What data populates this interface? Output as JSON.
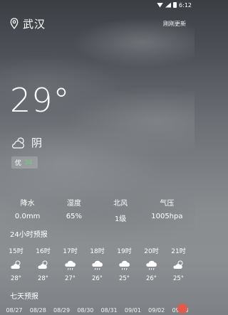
{
  "status_bar": {
    "time": "6:12"
  },
  "header": {
    "city": "武汉",
    "updated": "刚刚更新"
  },
  "current": {
    "temperature": "29°",
    "condition": "阴",
    "condition_icon": "cloud-sun-icon",
    "aqi_label": "优",
    "aqi_value": "34",
    "aqi_color": "#6fd06f"
  },
  "stats": [
    {
      "label": "降水",
      "value": "0.0mm"
    },
    {
      "label": "湿度",
      "value": "65%"
    },
    {
      "label": "北风",
      "value": "1级"
    },
    {
      "label": "气压",
      "value": "1005hpa"
    }
  ],
  "hourly_title": "24小时预报",
  "hourly": [
    {
      "time": "15时",
      "icon": "cloud-sun-icon",
      "temp": "28°"
    },
    {
      "time": "16时",
      "icon": "cloud-sun-icon",
      "temp": "28°"
    },
    {
      "time": "17时",
      "icon": "cloud-rain-icon",
      "temp": "27°"
    },
    {
      "time": "18时",
      "icon": "cloud-rain-icon",
      "temp": "26°"
    },
    {
      "time": "19时",
      "icon": "cloud-rain-icon",
      "temp": "25°"
    },
    {
      "time": "20时",
      "icon": "cloud-rain-icon",
      "temp": "26°"
    },
    {
      "time": "21时",
      "icon": "cloud-sun-icon",
      "temp": "25°"
    }
  ],
  "daily_title": "七天预报",
  "daily": [
    "08/27",
    "08/28",
    "08/29",
    "08/30",
    "08/31",
    "09/01",
    "09/02",
    "09/03"
  ]
}
